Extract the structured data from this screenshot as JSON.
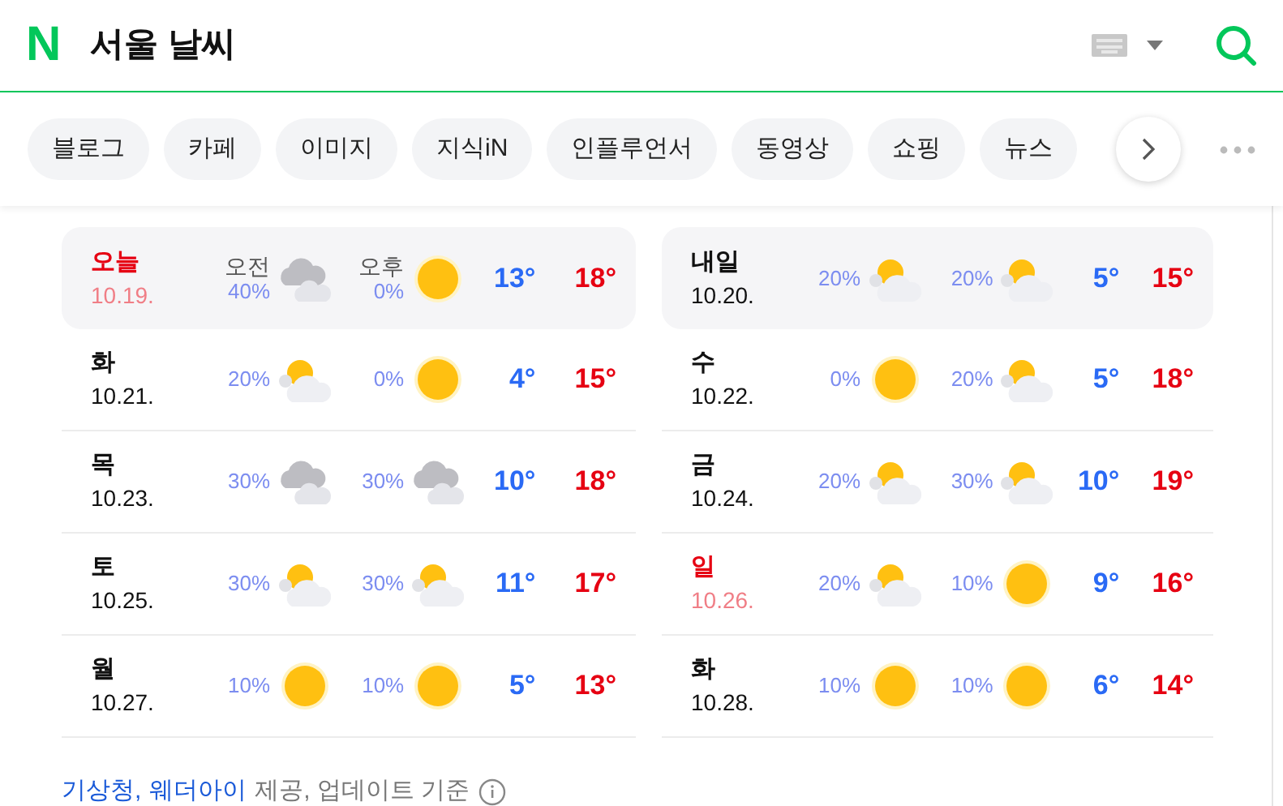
{
  "header": {
    "logo": "N",
    "query": "서울 날씨"
  },
  "tabs": [
    {
      "label": "블로그"
    },
    {
      "label": "카페"
    },
    {
      "label": "이미지"
    },
    {
      "label": "지식iN"
    },
    {
      "label": "인플루언서"
    },
    {
      "label": "동영상"
    },
    {
      "label": "쇼핑"
    },
    {
      "label": "뉴스"
    }
  ],
  "days": [
    {
      "day": "오늘",
      "date": "10.19.",
      "holiday": true,
      "highlighted": true,
      "am": {
        "label": "오전",
        "rain": "40%",
        "kind": "cloudy"
      },
      "pm": {
        "label": "오후",
        "rain": "0%",
        "kind": "sunny"
      },
      "low": "13°",
      "high": "18°"
    },
    {
      "day": "내일",
      "date": "10.20.",
      "holiday": false,
      "highlighted": true,
      "am": {
        "rain": "20%",
        "kind": "partly"
      },
      "pm": {
        "rain": "20%",
        "kind": "partly"
      },
      "low": "5°",
      "high": "15°"
    },
    {
      "day": "화",
      "date": "10.21.",
      "holiday": false,
      "highlighted": false,
      "am": {
        "rain": "20%",
        "kind": "partly"
      },
      "pm": {
        "rain": "0%",
        "kind": "sunny"
      },
      "low": "4°",
      "high": "15°"
    },
    {
      "day": "수",
      "date": "10.22.",
      "holiday": false,
      "highlighted": false,
      "am": {
        "rain": "0%",
        "kind": "sunny"
      },
      "pm": {
        "rain": "20%",
        "kind": "partly"
      },
      "low": "5°",
      "high": "18°"
    },
    {
      "day": "목",
      "date": "10.23.",
      "holiday": false,
      "highlighted": false,
      "am": {
        "rain": "30%",
        "kind": "cloudy"
      },
      "pm": {
        "rain": "30%",
        "kind": "cloudy"
      },
      "low": "10°",
      "high": "18°"
    },
    {
      "day": "금",
      "date": "10.24.",
      "holiday": false,
      "highlighted": false,
      "am": {
        "rain": "20%",
        "kind": "partly"
      },
      "pm": {
        "rain": "30%",
        "kind": "partly"
      },
      "low": "10°",
      "high": "19°"
    },
    {
      "day": "토",
      "date": "10.25.",
      "holiday": false,
      "highlighted": false,
      "am": {
        "rain": "30%",
        "kind": "partly"
      },
      "pm": {
        "rain": "30%",
        "kind": "partly"
      },
      "low": "11°",
      "high": "17°"
    },
    {
      "day": "일",
      "date": "10.26.",
      "holiday": true,
      "highlighted": false,
      "am": {
        "rain": "20%",
        "kind": "partly"
      },
      "pm": {
        "rain": "10%",
        "kind": "sunny"
      },
      "low": "9°",
      "high": "16°"
    },
    {
      "day": "월",
      "date": "10.27.",
      "holiday": false,
      "highlighted": false,
      "am": {
        "rain": "10%",
        "kind": "sunny"
      },
      "pm": {
        "rain": "10%",
        "kind": "sunny"
      },
      "low": "5°",
      "high": "13°"
    },
    {
      "day": "화",
      "date": "10.28.",
      "holiday": false,
      "highlighted": false,
      "am": {
        "rain": "10%",
        "kind": "sunny"
      },
      "pm": {
        "rain": "10%",
        "kind": "sunny"
      },
      "low": "6°",
      "high": "14°"
    }
  ],
  "footer": {
    "sources": [
      "기상청,",
      "웨더아이"
    ],
    "text": "제공, 업데이트 기준"
  }
}
